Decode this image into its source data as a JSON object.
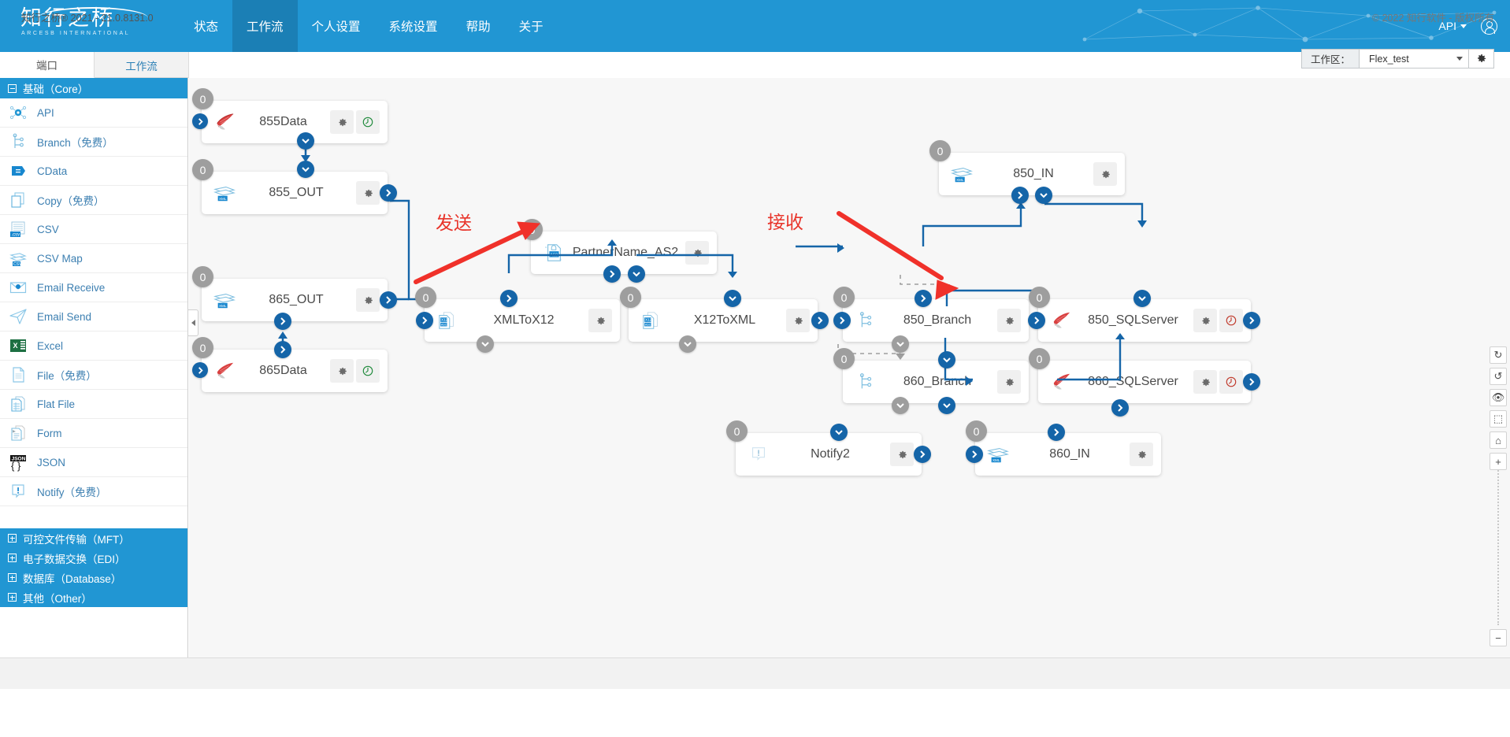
{
  "topnav": {
    "brand_cn": "知行之桥",
    "brand_en": "ARCESB INTERNATIONAL",
    "items": [
      {
        "label": "状态",
        "active": false
      },
      {
        "label": "工作流",
        "active": true
      },
      {
        "label": "个人设置",
        "active": false
      },
      {
        "label": "系统设置",
        "active": false
      },
      {
        "label": "帮助",
        "active": false
      },
      {
        "label": "关于",
        "active": false
      }
    ],
    "api_label": "API",
    "accent": "#2196d3",
    "accent_active": "#1b7fb5"
  },
  "tabs": [
    {
      "label": "端口",
      "active": true
    },
    {
      "label": "工作流",
      "active": false
    }
  ],
  "workspace": {
    "label": "工作区：",
    "value": "Flex_test",
    "gear_icon": "gear-icon"
  },
  "sidebar": {
    "core_header": {
      "label": "基础（Core）",
      "icon": "minus-box-icon"
    },
    "ports": [
      {
        "label": "API",
        "icon": "api-icon"
      },
      {
        "label": "Branch（免费）",
        "icon": "branch-icon"
      },
      {
        "label": "CData",
        "icon": "cdata-icon"
      },
      {
        "label": "Copy（免费）",
        "icon": "copy-icon"
      },
      {
        "label": "CSV",
        "icon": "csv-icon"
      },
      {
        "label": "CSV Map",
        "icon": "csv-map-icon"
      },
      {
        "label": "Email Receive",
        "icon": "email-receive-icon"
      },
      {
        "label": "Email Send",
        "icon": "email-send-icon"
      },
      {
        "label": "Excel",
        "icon": "excel-icon"
      },
      {
        "label": "File（免费）",
        "icon": "file-icon"
      },
      {
        "label": "Flat File",
        "icon": "flat-file-icon"
      },
      {
        "label": "Form",
        "icon": "form-icon"
      },
      {
        "label": "JSON",
        "icon": "json-icon"
      },
      {
        "label": "Notify（免费）",
        "icon": "notify-icon"
      }
    ],
    "categories": [
      {
        "label": "可控文件传输（MFT）",
        "icon": "plus-box-icon"
      },
      {
        "label": "电子数据交换（EDI）",
        "icon": "plus-box-icon"
      },
      {
        "label": "数据库（Database）",
        "icon": "plus-box-icon"
      },
      {
        "label": "其他（Other）",
        "icon": "plus-box-icon"
      }
    ]
  },
  "canvas": {
    "annotations": [
      {
        "text": "发送",
        "color": "#e8342a"
      },
      {
        "text": "接收",
        "color": "#e8342a"
      }
    ],
    "nodes": [
      {
        "id": "n855data",
        "label": "855Data",
        "icon": "sqlserver-icon",
        "badge": "0",
        "buttons": [
          "gear-icon",
          "clock-green-icon"
        ]
      },
      {
        "id": "n855out",
        "label": "855_OUT",
        "icon": "xmlmap-icon",
        "badge": "0",
        "buttons": [
          "gear-icon"
        ]
      },
      {
        "id": "n865out",
        "label": "865_OUT",
        "icon": "xmlmap-icon",
        "badge": "0",
        "buttons": [
          "gear-icon"
        ]
      },
      {
        "id": "n865data",
        "label": "865Data",
        "icon": "sqlserver-icon",
        "badge": "0",
        "buttons": [
          "gear-icon",
          "clock-green-icon"
        ]
      },
      {
        "id": "nas2",
        "label": "PartnerName_AS2",
        "icon": "as2-icon",
        "badge": "0",
        "buttons": [
          "gear-icon"
        ]
      },
      {
        "id": "nxmltox12",
        "label": "XMLToX12",
        "icon": "x12-icon",
        "badge": "0",
        "buttons": [
          "gear-icon"
        ]
      },
      {
        "id": "nx12toxml",
        "label": "X12ToXML",
        "icon": "x12-icon",
        "badge": "0",
        "buttons": [
          "gear-icon"
        ]
      },
      {
        "id": "n850in",
        "label": "850_IN",
        "icon": "xmlmap-icon",
        "badge": "0",
        "buttons": [
          "gear-icon"
        ]
      },
      {
        "id": "n850br",
        "label": "850_Branch",
        "icon": "branch-icon",
        "badge": "0",
        "buttons": [
          "gear-icon"
        ]
      },
      {
        "id": "n850sql",
        "label": "850_SQLServer",
        "icon": "sqlserver-icon",
        "badge": "0",
        "buttons": [
          "gear-icon",
          "clock-red-icon"
        ]
      },
      {
        "id": "n860br",
        "label": "860_Branch",
        "icon": "branch-icon",
        "badge": "0",
        "buttons": [
          "gear-icon"
        ]
      },
      {
        "id": "n860sql",
        "label": "860_SQLServer",
        "icon": "sqlserver-icon",
        "badge": "0",
        "buttons": [
          "gear-icon",
          "clock-red-icon"
        ]
      },
      {
        "id": "nnotify2",
        "label": "Notify2",
        "icon": "notify-icon",
        "badge": "0",
        "buttons": [
          "gear-icon"
        ]
      },
      {
        "id": "n860in",
        "label": "860_IN",
        "icon": "xmlmap-icon",
        "badge": "0",
        "buttons": [
          "gear-icon"
        ]
      }
    ],
    "tools": [
      {
        "name": "redo-icon",
        "glyph": "↻"
      },
      {
        "name": "undo-icon",
        "glyph": "↺"
      },
      {
        "name": "eye-icon",
        "glyph": "👁"
      },
      {
        "name": "selection-icon",
        "glyph": "⬚"
      },
      {
        "name": "home-icon",
        "glyph": "⌂"
      },
      {
        "name": "zoom-in-icon",
        "glyph": "+"
      }
    ],
    "zoom_out": {
      "name": "zoom-out-icon",
      "glyph": "−"
    }
  },
  "footer": {
    "left": "知行之桥® 2021 - 21.0.8131.0",
    "right": "© 2022 知行软件 - 版权所有"
  }
}
